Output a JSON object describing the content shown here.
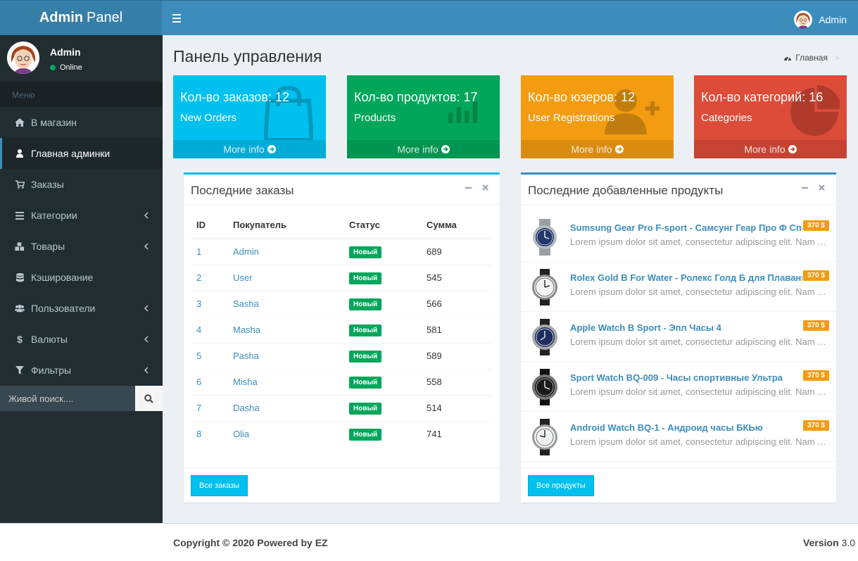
{
  "brand": {
    "bold": "Admin",
    "light": "Panel"
  },
  "header": {
    "user_name": "Admin"
  },
  "sidebar": {
    "user_name": "Admin",
    "user_status": "Online",
    "menu_header": "Меню",
    "items": [
      {
        "label": "В магазин",
        "icon": "home-icon"
      },
      {
        "label": "Главная админки",
        "icon": "user-icon"
      },
      {
        "label": "Заказы",
        "icon": "cart-icon"
      },
      {
        "label": "Категории",
        "icon": "bars-icon"
      },
      {
        "label": "Товары",
        "icon": "cubes-icon"
      },
      {
        "label": "Кэширование",
        "icon": "database-icon"
      },
      {
        "label": "Пользователи",
        "icon": "users-icon"
      },
      {
        "label": "Валюты",
        "icon": "dollar-icon"
      },
      {
        "label": "Фильтры",
        "icon": "filter-icon"
      }
    ],
    "search_placeholder": "Живой поиск...."
  },
  "page": {
    "title": "Панель управления",
    "breadcrumb": "Главная",
    "breadcrumb_sep": ">"
  },
  "stats": [
    {
      "title": "Кол-во заказов: 12",
      "subtitle": "New Orders",
      "footer": "More info",
      "color": "#00c0ef",
      "icon": "shopping-bag-icon"
    },
    {
      "title": "Кол-во продуктов: 17",
      "subtitle": "Products",
      "footer": "More info",
      "color": "#00a65a",
      "icon": "bar-chart-icon"
    },
    {
      "title": "Кол-во юзеров: 12",
      "subtitle": "User Registrations",
      "footer": "More info",
      "color": "#f39c12",
      "icon": "user-add-icon"
    },
    {
      "title": "Кол-во категорий: 16",
      "subtitle": "Categories",
      "footer": "More info",
      "color": "#dd4b39",
      "icon": "pie-chart-icon"
    }
  ],
  "orders": {
    "title": "Последние заказы",
    "columns": [
      "ID",
      "Покупатель",
      "Статус",
      "Сумма"
    ],
    "rows": [
      {
        "id": "1",
        "customer": "Admin",
        "status": "Новый",
        "sum": "689"
      },
      {
        "id": "2",
        "customer": "User",
        "status": "Новый",
        "sum": "545"
      },
      {
        "id": "3",
        "customer": "Sasha",
        "status": "Новый",
        "sum": "566"
      },
      {
        "id": "4",
        "customer": "Masha",
        "status": "Новый",
        "sum": "581"
      },
      {
        "id": "5",
        "customer": "Pasha",
        "status": "Новый",
        "sum": "589"
      },
      {
        "id": "6",
        "customer": "Misha",
        "status": "Новый",
        "sum": "558"
      },
      {
        "id": "7",
        "customer": "Dasha",
        "status": "Новый",
        "sum": "514"
      },
      {
        "id": "8",
        "customer": "Olia",
        "status": "Новый",
        "sum": "741"
      }
    ],
    "button": "Все заказы"
  },
  "products": {
    "title": "Последние добавленные продукты",
    "items": [
      {
        "name": "Sumsung Gear Pro F-sport - Самсунг Геар Про Ф Спорт",
        "desc": "Lorem ipsum dolor sit amet, consectetur adipiscing elit. Nam ornare",
        "price": "370 $"
      },
      {
        "name": "Rolex Gold B For Water - Ролекс Голд Б для Плавания",
        "desc": "Lorem ipsum dolor sit amet, consectetur adipiscing elit. Nam ornare",
        "price": "370 $"
      },
      {
        "name": "Apple Watch B Sport - Эпл Часы 4",
        "desc": "Lorem ipsum dolor sit amet, consectetur adipiscing elit. Nam ornare",
        "price": "370 $"
      },
      {
        "name": "Sport Watch BQ-009 - Часы спортивные Ультра",
        "desc": "Lorem ipsum dolor sit amet, consectetur adipiscing elit. Nam ornare",
        "price": "370 $"
      },
      {
        "name": "Android Watch BQ-1 - Андроид часы БКЬю",
        "desc": "Lorem ipsum dolor sit amet, consectetur adipiscing elit. Nam ornare",
        "price": "370 $"
      }
    ],
    "button": "Все продукты"
  },
  "footer": {
    "copyright": "Copyright © 2020 Powered by EZ",
    "version_label": "Version",
    "version": "3.0"
  }
}
